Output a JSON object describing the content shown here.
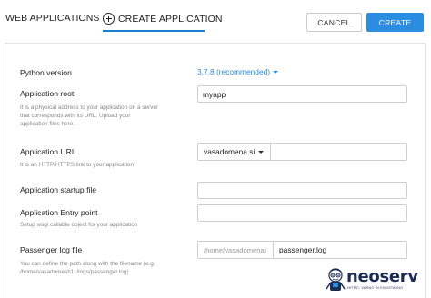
{
  "header": {
    "tab_web": "WEB APPLICATIONS",
    "tab_create": "CREATE APPLICATION",
    "cancel_label": "CANCEL",
    "create_label": "CREATE"
  },
  "form": {
    "python_version": {
      "label": "Python version",
      "value": "3.7.8 (recommended)"
    },
    "app_root": {
      "label": "Application root",
      "help": [
        "It is a physical address to your application on a server",
        "that corresponds with its URL. Upload your",
        "application files here."
      ],
      "value": "myapp"
    },
    "app_url": {
      "label": "Application URL",
      "help": "It is an HTTP/HTTPS link to your application",
      "domain": "vasadomena.si",
      "value": ""
    },
    "startup_file": {
      "label": "Application startup file",
      "value": ""
    },
    "entry_point": {
      "label": "Application Entry point",
      "help": "Setup wsgi callable object for your application",
      "value": ""
    },
    "passenger_log": {
      "label": "Passenger log file",
      "help": [
        "You can define the path along with the filename (e.g.",
        "/home/vasadomesh11/logs/passenger.log)"
      ],
      "prefix": "/home/vasadomena/",
      "value": "passenger.log"
    }
  },
  "logo": {
    "name": "neoserv",
    "tagline": "HITRO, VARNO IN ENOSTAVNO"
  },
  "colors": {
    "accent": "#2b8de0",
    "tab_underline": "#1a7fd1",
    "logo": "#1b2d55"
  }
}
